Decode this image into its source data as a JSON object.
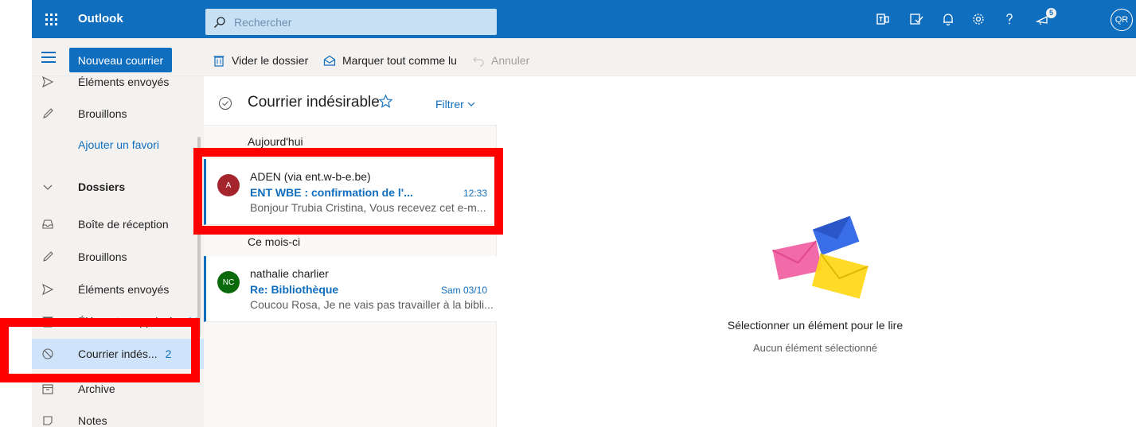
{
  "header": {
    "app_name": "Outlook",
    "search_placeholder": "Rechercher",
    "notifications_badge": "5",
    "user_initials": "QR"
  },
  "command_bar": {
    "new_mail_label": "Nouveau courrier",
    "empty_folder_label": "Vider le dossier",
    "mark_all_read_label": "Marquer tout comme lu",
    "undo_label": "Annuler"
  },
  "left_nav": {
    "items": [
      {
        "label": "Éléments envoyés",
        "icon": "send-icon"
      },
      {
        "label": "Brouillons",
        "icon": "pencil-icon"
      },
      {
        "label": "Ajouter un favori",
        "icon": ""
      },
      {
        "label": "Dossiers",
        "icon": "chevron-down-icon"
      },
      {
        "label": "Boîte de réception",
        "icon": "inbox-icon"
      },
      {
        "label": "Brouillons",
        "icon": "pencil-icon"
      },
      {
        "label": "Éléments envoyés",
        "icon": "send-icon"
      },
      {
        "label": "Éléments supprimés",
        "icon": "trash-icon",
        "count": "21"
      },
      {
        "label": "Courrier indés...",
        "icon": "blocked-icon",
        "count": "2",
        "selected": true
      },
      {
        "label": "Archive",
        "icon": "archive-icon"
      },
      {
        "label": "Notes",
        "icon": "note-icon"
      }
    ]
  },
  "message_list": {
    "folder_title": "Courrier indésirable",
    "filter_label": "Filtrer",
    "groups": [
      {
        "label": "Aujourd'hui",
        "messages": [
          {
            "initials": "A",
            "avatar_color": "#a4262c",
            "sender": "ADEN (via ent.w-b-e.be)",
            "subject": "ENT WBE : confirmation de l'...",
            "time": "12:33",
            "preview": "Bonjour Trubia Cristina, Vous recevez cet e-m..."
          }
        ]
      },
      {
        "label": "Ce mois-ci",
        "messages": [
          {
            "initials": "NC",
            "avatar_color": "#0b6a0b",
            "sender": "nathalie charlier",
            "subject": "Re: Bibliothèque",
            "time": "Sam 03/10",
            "preview": "Coucou Rosa, Je ne vais pas travailler à la bibli..."
          }
        ]
      }
    ]
  },
  "reading_pane": {
    "empty_title": "Sélectionner un élément pour le lire",
    "empty_subtitle": "Aucun élément sélectionné"
  },
  "colors": {
    "brand": "#106ebe",
    "highlight": "#ff0000"
  }
}
